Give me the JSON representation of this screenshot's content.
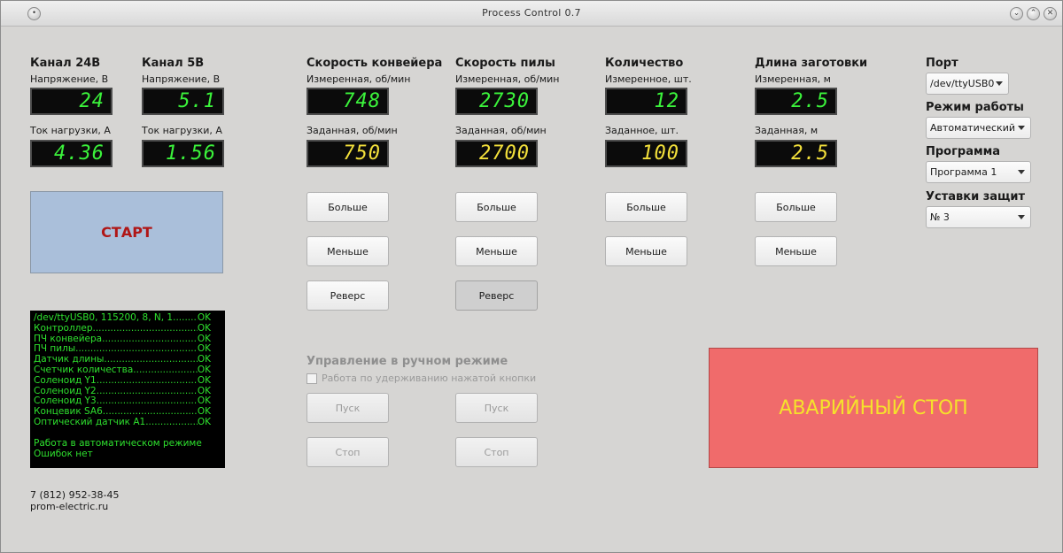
{
  "window": {
    "title": "Process Control 0.7"
  },
  "ch24": {
    "header": "Канал 24В",
    "voltage_label": "Напряжение, В",
    "voltage": "24",
    "current_label": "Ток нагрузки, А",
    "current": "4.36"
  },
  "ch5": {
    "header": "Канал 5В",
    "voltage_label": "Напряжение, В",
    "voltage": "5.1",
    "current_label": "Ток нагрузки, А",
    "current": "1.56"
  },
  "conveyor": {
    "header": "Скорость конвейера",
    "measured_label": "Измеренная, об/мин",
    "measured": "748",
    "set_label": "Заданная, об/мин",
    "set": "750",
    "more": "Больше",
    "less": "Меньше",
    "reverse": "Реверс"
  },
  "saw": {
    "header": "Скорость пилы",
    "measured_label": "Измеренная, об/мин",
    "measured": "2730",
    "set_label": "Заданная, об/мин",
    "set": "2700",
    "more": "Больше",
    "less": "Меньше",
    "reverse": "Реверс"
  },
  "quantity": {
    "header": "Количество",
    "measured_label": "Измеренное, шт.",
    "measured": "12",
    "set_label": "Заданное, шт.",
    "set": "100",
    "more": "Больше",
    "less": "Меньше"
  },
  "length": {
    "header": "Длина заготовки",
    "measured_label": "Измеренная, м",
    "measured": "2.5",
    "set_label": "Заданная, м",
    "set": "2.5",
    "more": "Больше",
    "less": "Меньше"
  },
  "start": {
    "label": "СТАРТ"
  },
  "log": {
    "lines": [
      {
        "name": "/dev/ttyUSB0, 115200, 8, N, 1",
        "status": "OK"
      },
      {
        "name": "Контроллер",
        "status": "OK"
      },
      {
        "name": "ПЧ конвейера",
        "status": "OK"
      },
      {
        "name": "ПЧ пилы",
        "status": "OK"
      },
      {
        "name": "Датчик длины",
        "status": "OK"
      },
      {
        "name": "Счетчик количества",
        "status": "OK"
      },
      {
        "name": "Соленоид Y1",
        "status": "OK"
      },
      {
        "name": "Соленоид Y2",
        "status": "OK"
      },
      {
        "name": "Соленоид Y3",
        "status": "OK"
      },
      {
        "name": "Концевик SA6",
        "status": "OK"
      },
      {
        "name": "Оптический датчик A1",
        "status": "OK"
      }
    ],
    "mode_line": "Работа в автоматическом режиме",
    "errors_line": "Ошибок нет"
  },
  "manual": {
    "header": "Управление в ручном режиме",
    "hold_checkbox": "Работа по удерживанию нажатой кнопки",
    "hold_checked": false,
    "start1": "Пуск",
    "stop1": "Стоп",
    "start2": "Пуск",
    "stop2": "Стоп"
  },
  "estop": {
    "label": "АВАРИЙНЫЙ СТОП"
  },
  "settings": {
    "port_label": "Порт",
    "port_value": "/dev/ttyUSB0",
    "mode_label": "Режим работы",
    "mode_value": "Автоматический",
    "program_label": "Программа",
    "program_value": "Программа 1",
    "protect_label": "Уставки защит",
    "protect_value": "№ 3"
  },
  "footer": {
    "phone": "7 (812) 952-38-45",
    "site": "prom-electric.ru"
  },
  "colors": {
    "display_measured": "#3bf33b",
    "display_set": "#f3e03b",
    "start_bg": "#aabfda",
    "start_text": "#b01616",
    "estop_bg": "#f06b6b",
    "estop_text": "#f5e12c",
    "log_text": "#2ee02e"
  }
}
